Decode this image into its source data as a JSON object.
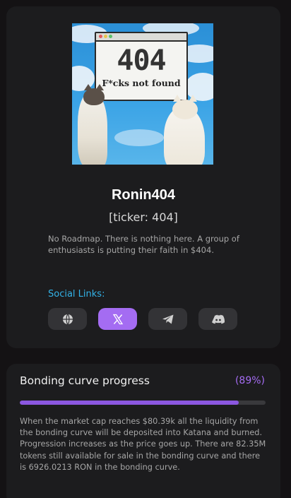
{
  "token": {
    "name": "Ronin404",
    "ticker": "[ticker: 404]",
    "description": "No Roadmap. There is nothing here. A group of enthusiasts is putting their faith in $404.",
    "image": {
      "big_text": "404",
      "sub_text": "F*cks not found"
    }
  },
  "social": {
    "title": "Social Links:",
    "links": [
      {
        "icon": "globe-icon",
        "active": false
      },
      {
        "icon": "x-icon",
        "active": true
      },
      {
        "icon": "telegram-icon",
        "active": false
      },
      {
        "icon": "discord-icon",
        "active": false
      }
    ]
  },
  "bonding": {
    "title": "Bonding curve progress",
    "percent_label": "(89%)",
    "progress": 0.89,
    "description": "When the market cap reaches $80.39k all the liquidity from the bonding curve will be deposited into Katana and burned. Progression increases as the price goes up. There are 82.35M tokens still available for sale in the bonding curve and there is 6926.0213 RON in the bonding curve."
  },
  "colors": {
    "accent": "#a46cf2",
    "link_title": "#33b3e8",
    "card_bg": "#1c1c1e",
    "page_bg": "#141214"
  }
}
